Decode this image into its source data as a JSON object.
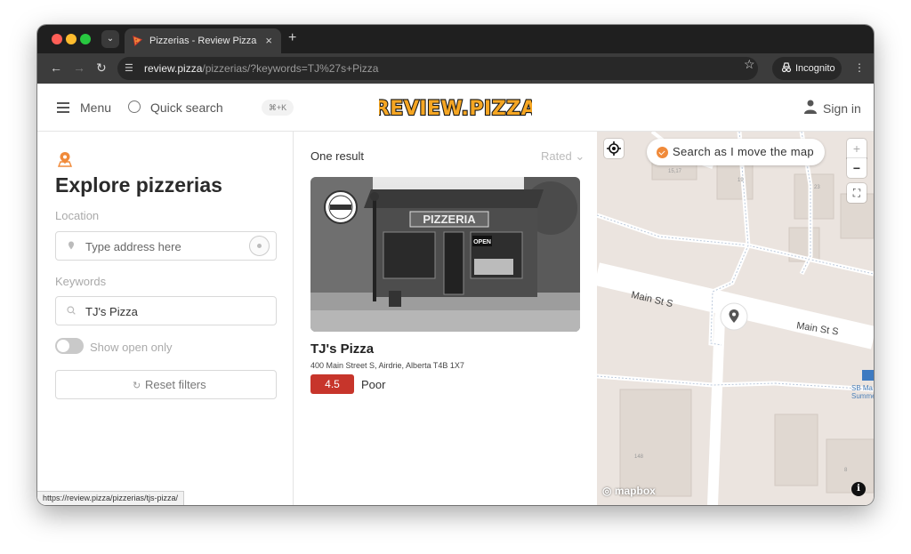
{
  "browser": {
    "tab_title": "Pizzerias - Review Pizza",
    "url_host": "review.pizza",
    "url_path": "/pizzerias/?keywords=TJ%27s+Pizza",
    "incognito_label": "Incognito",
    "status_url": "https://review.pizza/pizzerias/tjs-pizza/"
  },
  "header": {
    "menu_label": "Menu",
    "quick_search_label": "Quick search",
    "quick_search_shortcut": "⌘+K",
    "logo_text": "REVIEW.PIZZA",
    "sign_in_label": "Sign in"
  },
  "sidebar": {
    "title": "Explore pizzerias",
    "location_label": "Location",
    "location_placeholder": "Type address here",
    "keywords_label": "Keywords",
    "keywords_value": "TJ's Pizza",
    "show_open_label": "Show open only",
    "reset_label": "Reset filters"
  },
  "results": {
    "count_label": "One result",
    "sort_label": "Rated",
    "card": {
      "name": "TJ's Pizza",
      "address": "400 Main Street S, Airdrie, Alberta T4B 1X7",
      "rating": "4.5",
      "rating_text": "Poor",
      "image_sign": "PIZZERIA",
      "image_open_sign": "OPEN"
    }
  },
  "map": {
    "search_as_move_label": "Search as I move the map",
    "street_label_1": "Main St S",
    "street_label_2": "Main St S",
    "poi_label_line1": "SB Ma",
    "poi_label_line2": "Summe",
    "attribution": "mapbox",
    "building_numbers": [
      "15,17",
      "19",
      "23",
      "148",
      "8"
    ]
  },
  "colors": {
    "accent_orange": "#f08a3a",
    "rating_red": "#c7352b",
    "map_background": "#ebe4df"
  }
}
